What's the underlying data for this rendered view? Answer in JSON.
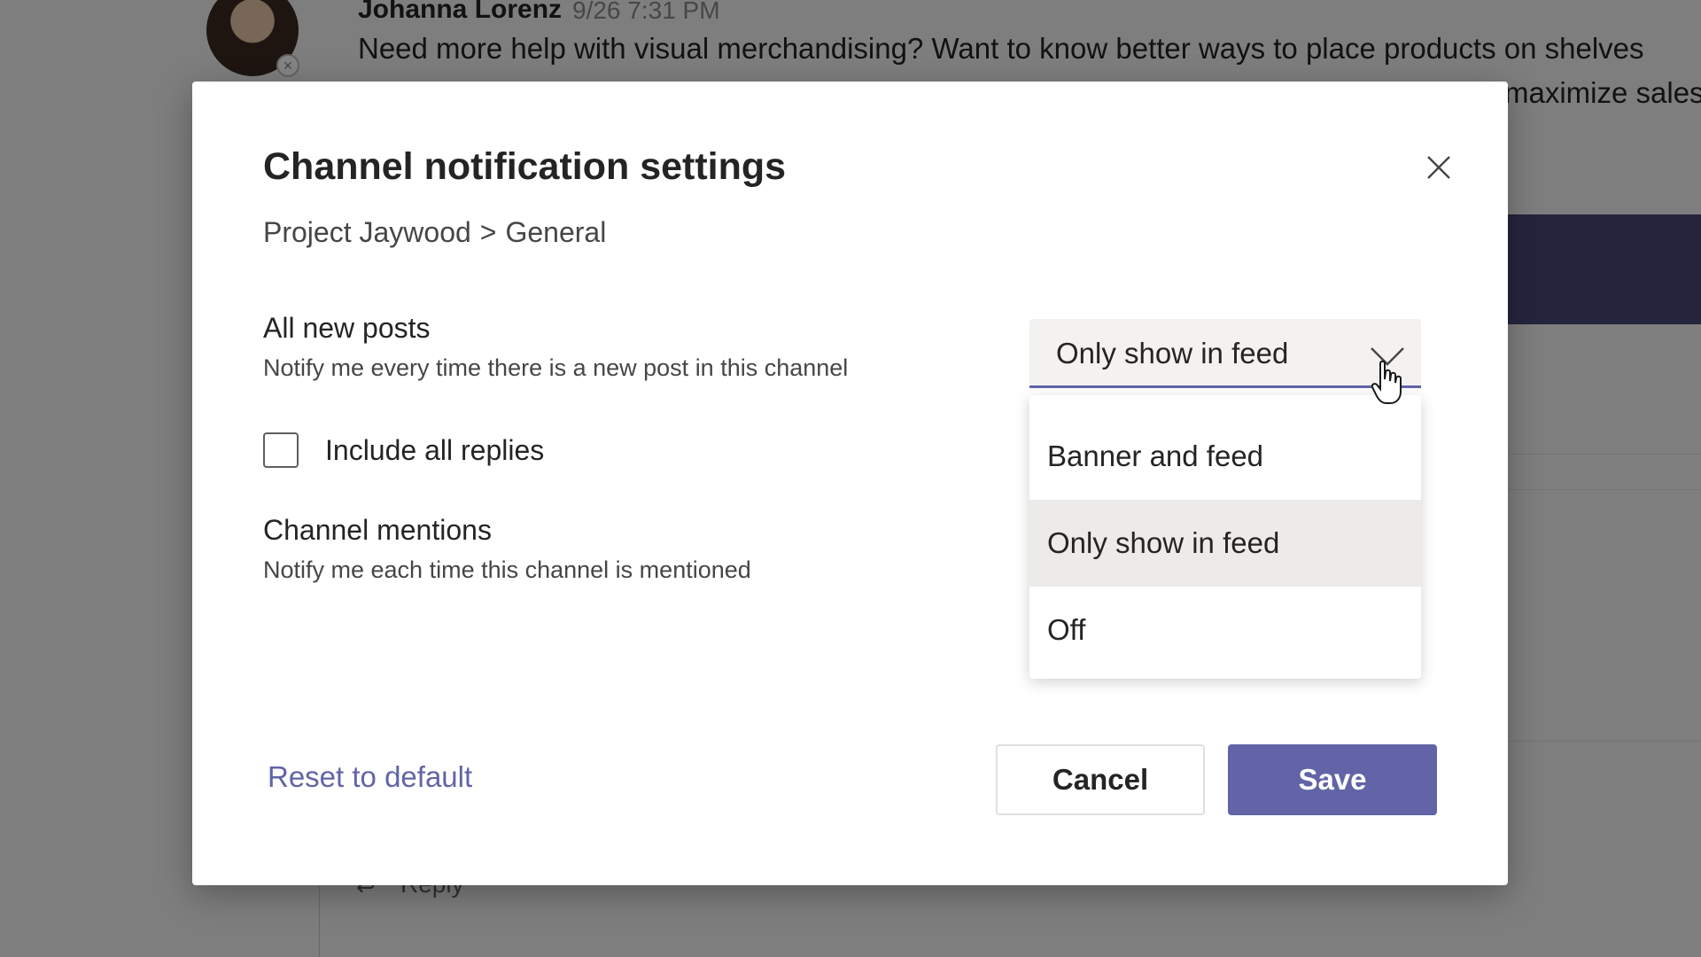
{
  "background": {
    "author": "Johanna Lorenz",
    "time": "9/26 7:31 PM",
    "message_line1": "Need more help with visual merchandising? Want to know better ways to place products on shelves",
    "message_line2": "maximize sales.",
    "reply_label": "Reply"
  },
  "dialog": {
    "title": "Channel notification settings",
    "breadcrumb": {
      "team": "Project Jaywood",
      "separator": ">",
      "channel": "General"
    },
    "all_posts": {
      "label": "All new posts",
      "description": "Notify me every time there is a new post in this channel",
      "selected": "Only show in feed"
    },
    "include_replies": {
      "label": "Include all replies",
      "checked": false
    },
    "mentions": {
      "label": "Channel mentions",
      "description": "Notify me each time this channel is mentioned"
    },
    "dropdown_options": [
      {
        "label": "Banner and feed",
        "selected": false
      },
      {
        "label": "Only show in feed",
        "selected": true
      },
      {
        "label": "Off",
        "selected": false
      }
    ],
    "reset_label": "Reset to default",
    "cancel_label": "Cancel",
    "save_label": "Save"
  },
  "colors": {
    "accent": "#6264a7",
    "overlay": "rgba(0,0,0,0.48)"
  },
  "icons": {
    "close": "close-icon",
    "chevron": "chevron-down-icon",
    "cursor": "hand-pointer-icon"
  }
}
